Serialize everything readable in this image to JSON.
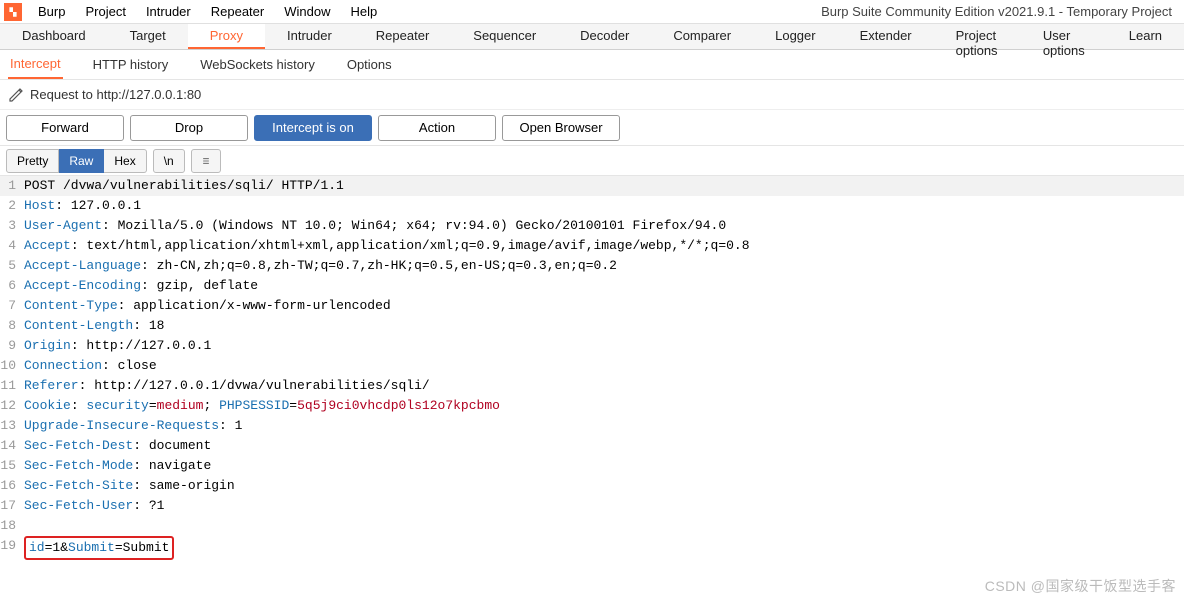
{
  "title_right": "Burp Suite Community Edition v2021.9.1 - Temporary Project",
  "menubar": [
    "Burp",
    "Project",
    "Intruder",
    "Repeater",
    "Window",
    "Help"
  ],
  "main_tabs": [
    "Dashboard",
    "Target",
    "Proxy",
    "Intruder",
    "Repeater",
    "Sequencer",
    "Decoder",
    "Comparer",
    "Logger",
    "Extender",
    "Project options",
    "User options",
    "Learn"
  ],
  "main_tab_active": "Proxy",
  "sub_tabs": [
    "Intercept",
    "HTTP history",
    "WebSockets history",
    "Options"
  ],
  "sub_tab_active": "Intercept",
  "request_label": "Request to http://127.0.0.1:80",
  "buttons": {
    "forward": "Forward",
    "drop": "Drop",
    "intercept": "Intercept is on",
    "action": "Action",
    "open_browser": "Open Browser"
  },
  "view_modes": {
    "pretty": "Pretty",
    "raw": "Raw",
    "hex": "Hex",
    "newline": "\\n"
  },
  "request_lines": [
    {
      "n": 1,
      "type": "start",
      "text": "POST /dvwa/vulnerabilities/sqli/ HTTP/1.1"
    },
    {
      "n": 2,
      "type": "header",
      "key": "Host",
      "val": " 127.0.0.1"
    },
    {
      "n": 3,
      "type": "header",
      "key": "User-Agent",
      "val": " Mozilla/5.0 (Windows NT 10.0; Win64; x64; rv:94.0) Gecko/20100101 Firefox/94.0"
    },
    {
      "n": 4,
      "type": "header",
      "key": "Accept",
      "val": " text/html,application/xhtml+xml,application/xml;q=0.9,image/avif,image/webp,*/*;q=0.8"
    },
    {
      "n": 5,
      "type": "header",
      "key": "Accept-Language",
      "val": " zh-CN,zh;q=0.8,zh-TW;q=0.7,zh-HK;q=0.5,en-US;q=0.3,en;q=0.2"
    },
    {
      "n": 6,
      "type": "header",
      "key": "Accept-Encoding",
      "val": " gzip, deflate"
    },
    {
      "n": 7,
      "type": "header",
      "key": "Content-Type",
      "val": " application/x-www-form-urlencoded"
    },
    {
      "n": 8,
      "type": "header",
      "key": "Content-Length",
      "val": " 18"
    },
    {
      "n": 9,
      "type": "header",
      "key": "Origin",
      "val": " http://127.0.0.1"
    },
    {
      "n": 10,
      "type": "header",
      "key": "Connection",
      "val": " close"
    },
    {
      "n": 11,
      "type": "header",
      "key": "Referer",
      "val": " http://127.0.0.1/dvwa/vulnerabilities/sqli/"
    },
    {
      "n": 12,
      "type": "cookie",
      "key": "Cookie",
      "pairs": [
        {
          "k": "security",
          "v": "medium"
        },
        {
          "k": "PHPSESSID",
          "v": "5q5j9ci0vhcdp0ls12o7kpcbmo"
        }
      ]
    },
    {
      "n": 13,
      "type": "header",
      "key": "Upgrade-Insecure-Requests",
      "val": " 1"
    },
    {
      "n": 14,
      "type": "header",
      "key": "Sec-Fetch-Dest",
      "val": " document"
    },
    {
      "n": 15,
      "type": "header",
      "key": "Sec-Fetch-Mode",
      "val": " navigate"
    },
    {
      "n": 16,
      "type": "header",
      "key": "Sec-Fetch-Site",
      "val": " same-origin"
    },
    {
      "n": 17,
      "type": "header",
      "key": "Sec-Fetch-User",
      "val": " ?1"
    },
    {
      "n": 18,
      "type": "blank"
    },
    {
      "n": 19,
      "type": "body",
      "pairs": [
        {
          "k": "id",
          "v": "1"
        },
        {
          "k": "Submit",
          "v": "Submit"
        }
      ]
    }
  ],
  "watermark": "CSDN @国家级干饭型选手客"
}
